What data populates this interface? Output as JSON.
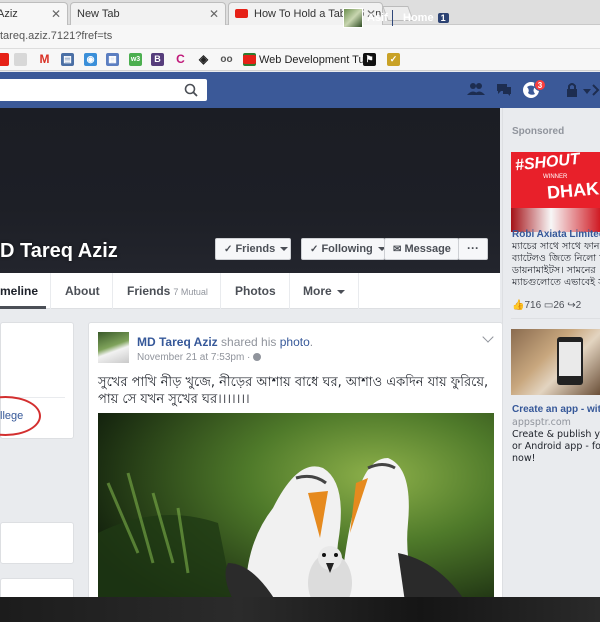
{
  "browser": {
    "tabs": [
      {
        "label": "Aziz",
        "active": true
      },
      {
        "label": "New Tab",
        "active": false
      },
      {
        "label": "How To Hold a Table Tenn",
        "active": false
      }
    ],
    "url": "tareq.aziz.7121?fref=ts",
    "bookmarks": {
      "web_dev_label": "Web Development Tu"
    }
  },
  "fb_bar": {
    "search_placeholder": "",
    "user_name": "Asif",
    "home_label": "Home",
    "home_count": "1",
    "notification_count": "3",
    "color": "#3b5998"
  },
  "profile": {
    "name": "D Tareq Aziz",
    "buttons": {
      "friends": "Friends",
      "following": "Following",
      "message": "Message",
      "more": "···"
    },
    "nav": {
      "timeline": "meline",
      "about": "About",
      "friends": "Friends",
      "mutual": "7 Mutual",
      "photos": "Photos",
      "more": "More"
    }
  },
  "left": {
    "college_link": "llege"
  },
  "post": {
    "author": "MD Tareq Aziz",
    "action_pre": "shared his",
    "action_link": "photo",
    "action_post": ".",
    "time": "November 21 at 7:53pm",
    "text": "সুখের পাখি নীড় খুজে, নীড়ের আশায় বাধে ঘর, আশাও একদিন যায় ফুরিয়ে, পায় সে যখন সুখের ঘর।।।।।।।"
  },
  "sidebar": {
    "sponsored": "Sponsored",
    "ad1": {
      "img_text_top": "#SHOUT",
      "img_text_mid": "WINNER",
      "img_text_bottom": "DHAKA",
      "title": "Robi Axiata Limited",
      "lines": [
        "ম্যাচের সাথে সাথে ফান",
        "ব্যাটেলও জিতে নিলো ঢা",
        "ডায়নামাইটস। সামনের",
        "ম্যাচগুলোতে এভাবেই স"
      ],
      "likes": "716",
      "comments": "26",
      "shares": "2"
    },
    "ad2": {
      "title": "Create an app - witho",
      "domain": "appsptr.com",
      "lines": [
        "Create & publish your",
        "or Android app - for fre",
        "now!"
      ]
    }
  }
}
